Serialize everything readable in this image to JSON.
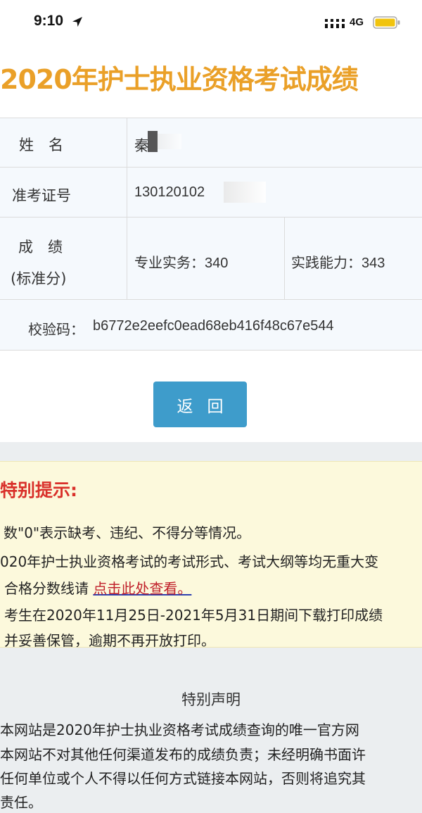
{
  "status_bar": {
    "time": "9:10",
    "network": "4G"
  },
  "page_title": "2020年护士执业资格考试成绩",
  "result_table": {
    "name_label": "姓　名",
    "name_value": "秦",
    "exam_id_label": "准考证号",
    "exam_id_value": "130120102",
    "score_label_line1": "成　绩",
    "score_label_line2": "(标准分)",
    "professional_practice": "专业实务：340",
    "practical_ability": "实践能力：343",
    "checksum_label": "校验码：",
    "checksum_value": "b6772e2eefc0ead68eb416f48c67e544"
  },
  "back_button": "返回",
  "notice": {
    "title": "特别提示:",
    "line1": "数\"0\"表示缺考、违纪、不得分等情况。",
    "line2": "020年护士执业资格考试的考试形式、考试大纲等均无重大变",
    "line3_prefix": "合格分数线请",
    "line3_link": "点击此处查看。",
    "line4": "考生在2020年11月25日-2021年5月31日期间下载打印成绩",
    "line5": "并妥善保管，逾期不再开放打印。"
  },
  "declaration": {
    "title": "特别声明",
    "line1": "本网站是2020年护士执业资格考试成绩查询的唯一官方网",
    "line2": "本网站不对其他任何渠道发布的成绩负责；未经明确书面许",
    "line3": "任何单位或个人不得以任何方式链接本网站，否则将追究其",
    "line4": "责任。"
  },
  "colors": {
    "title": "#eaa028",
    "button": "#3e9ccb",
    "notice_bg": "#fcf9dc",
    "notice_title": "#d9302a",
    "link": "#c0202a"
  }
}
